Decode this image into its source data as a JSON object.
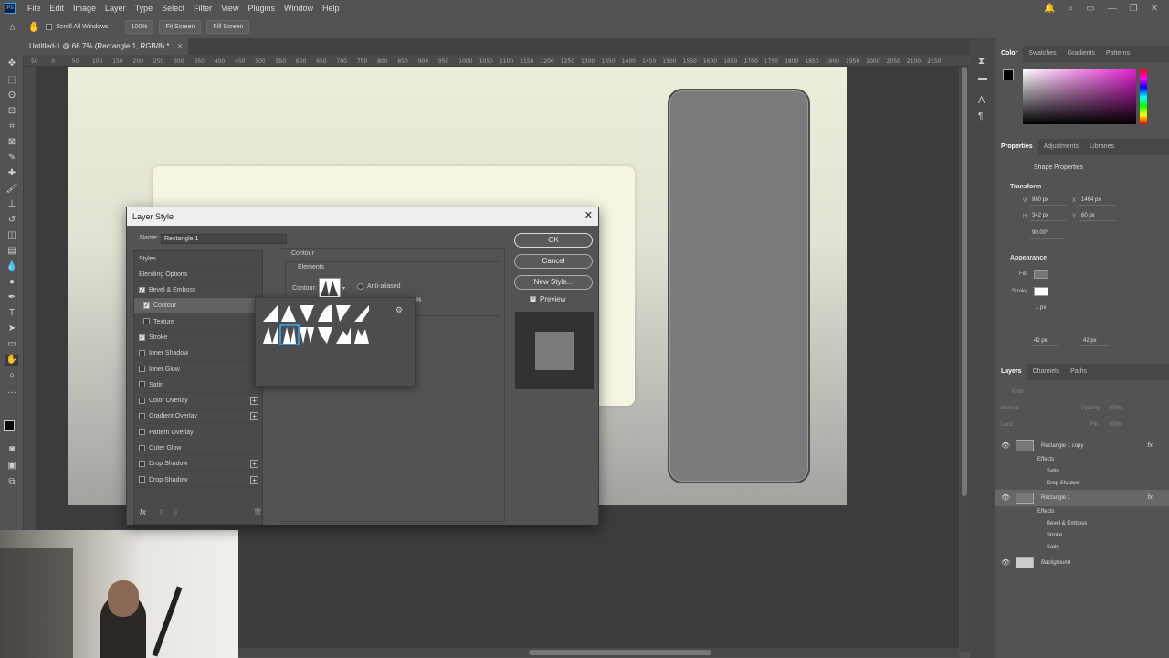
{
  "app": {
    "logo": "Ps"
  },
  "menu": [
    "File",
    "Edit",
    "Image",
    "Layer",
    "Type",
    "Select",
    "Filter",
    "View",
    "Plugins",
    "Window",
    "Help"
  ],
  "options_bar": {
    "scroll_all": "Scroll All Windows",
    "zoom": "100%",
    "fit_screen": "Fit Screen",
    "fill_screen": "Fill Screen"
  },
  "document_tab": "Untitled-1 @ 66.7% (Rectangle 1, RGB/8) *",
  "ruler_ticks": [
    "50",
    "0",
    "50",
    "100",
    "150",
    "200",
    "250",
    "300",
    "350",
    "400",
    "450",
    "500",
    "550",
    "600",
    "650",
    "700",
    "750",
    "800",
    "850",
    "900",
    "950",
    "1000",
    "1050",
    "1100",
    "1150",
    "1200",
    "1250",
    "1300",
    "1350",
    "1400",
    "1450",
    "1500",
    "1550",
    "1600",
    "1650",
    "1700",
    "1750",
    "1800",
    "1850",
    "1900",
    "1950",
    "2000",
    "2050",
    "2100",
    "2150"
  ],
  "dialog": {
    "title": "Layer Style",
    "name_label": "Name:",
    "name_value": "Rectangle 1",
    "styles_header": "Styles",
    "blending": "Blending Options",
    "items": [
      {
        "label": "Bevel & Emboss",
        "checked": true,
        "plus": false,
        "indent": false
      },
      {
        "label": "Contour",
        "checked": true,
        "plus": false,
        "indent": true
      },
      {
        "label": "Texture",
        "checked": false,
        "plus": false,
        "indent": true
      },
      {
        "label": "Stroke",
        "checked": true,
        "plus": false,
        "indent": false
      },
      {
        "label": "Inner Shadow",
        "checked": false,
        "plus": false,
        "indent": false
      },
      {
        "label": "Inner Glow",
        "checked": false,
        "plus": false,
        "indent": false
      },
      {
        "label": "Satin",
        "checked": false,
        "plus": false,
        "indent": false
      },
      {
        "label": "Color Overlay",
        "checked": false,
        "plus": true,
        "indent": false
      },
      {
        "label": "Gradient Overlay",
        "checked": false,
        "plus": true,
        "indent": false
      },
      {
        "label": "Pattern Overlay",
        "checked": false,
        "plus": false,
        "indent": false
      },
      {
        "label": "Outer Glow",
        "checked": false,
        "plus": false,
        "indent": false
      },
      {
        "label": "Drop Shadow",
        "checked": false,
        "plus": true,
        "indent": false
      },
      {
        "label": "Drop Shadow",
        "checked": false,
        "plus": true,
        "indent": false
      }
    ],
    "fx_label": "fx",
    "contour_title": "Contour",
    "elements_title": "Elements",
    "contour_label": "Contour:",
    "anti_aliased": "Anti-aliased",
    "range_pct": "%",
    "ok": "OK",
    "cancel": "Cancel",
    "new_style": "New Style...",
    "preview": "Preview"
  },
  "panels": {
    "color_tabs": [
      "Color",
      "Swatches",
      "Gradients",
      "Patterns"
    ],
    "props_tabs": [
      "Properties",
      "Adjustments",
      "Libraries"
    ],
    "shape_properties": "Shape Properties",
    "transform": "Transform",
    "w": "W",
    "w_val": "960 px",
    "x": "X",
    "x_val": "1464 px",
    "h": "H",
    "h_val": "342 px",
    "y": "Y",
    "y_val": "60 px",
    "angle": "90.00°",
    "appearance": "Appearance",
    "fill": "Fill",
    "stroke": "Stroke",
    "stroke_w": "1 px",
    "radius_1": "42 px",
    "radius_2": "42 px",
    "layers_tabs": [
      "Layers",
      "Channels",
      "Paths"
    ],
    "kind": "Kind",
    "blend": "Normal",
    "opacity": "Opacity:",
    "opacity_val": "100%",
    "lock": "Lock:",
    "fill_label": "Fill:",
    "fill_val": "100%",
    "layers": [
      {
        "name": "Rectangle 1 copy",
        "type": "layer",
        "fx": true
      },
      {
        "name": "Effects",
        "type": "effects-head"
      },
      {
        "name": "Satin",
        "type": "effect"
      },
      {
        "name": "Drop Shadow",
        "type": "effect"
      },
      {
        "name": "Rectangle 1",
        "type": "layer",
        "fx": true,
        "selected": true
      },
      {
        "name": "Effects",
        "type": "effects-head"
      },
      {
        "name": "Bevel & Emboss",
        "type": "effect"
      },
      {
        "name": "Stroke",
        "type": "effect"
      },
      {
        "name": "Satin",
        "type": "effect"
      },
      {
        "name": "Background",
        "type": "bg"
      }
    ]
  },
  "colors": {
    "accent": "#31a8ff",
    "panel": "#535353",
    "doc_bg": "#ededdb",
    "phone": "#7a7a7a"
  }
}
